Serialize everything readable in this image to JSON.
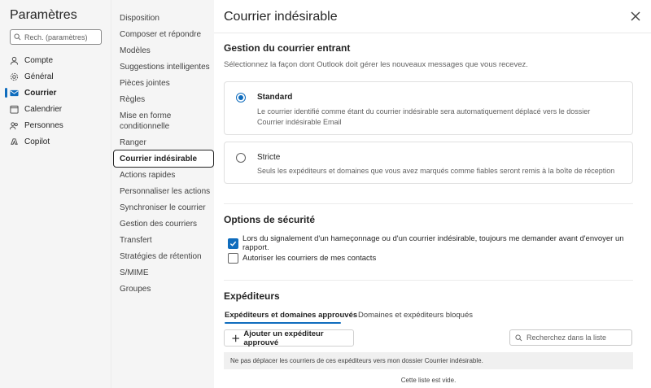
{
  "nav": {
    "title": "Paramètres",
    "search_placeholder": "Rech. (paramètres)",
    "items": [
      {
        "label": "Compte",
        "icon": "person-icon"
      },
      {
        "label": "Général",
        "icon": "gear-icon"
      },
      {
        "label": "Courrier",
        "icon": "mail-icon",
        "active": true
      },
      {
        "label": "Calendrier",
        "icon": "calendar-icon"
      },
      {
        "label": "Personnes",
        "icon": "people-icon"
      },
      {
        "label": "Copilot",
        "icon": "copilot-icon"
      }
    ]
  },
  "subnav": {
    "items": [
      "Disposition",
      "Composer et répondre",
      "Modèles",
      "Suggestions intelligentes",
      "Pièces jointes",
      "Règles",
      "Mise en forme conditionnelle",
      "Ranger",
      "Courrier indésirable",
      "Actions rapides",
      "Personnaliser les actions",
      "Synchroniser le courrier",
      "Gestion des courriers",
      "Transfert",
      "Stratégies de rétention",
      "S/MIME",
      "Groupes"
    ],
    "selected": "Courrier indésirable"
  },
  "main": {
    "title": "Courrier indésirable",
    "incoming": {
      "heading": "Gestion du courrier entrant",
      "description": "Sélectionnez la façon dont Outlook doit gérer les nouveaux messages que vous recevez.",
      "options": [
        {
          "title": "Standard",
          "description": "Le courrier identifié comme étant du courrier indésirable sera automatiquement déplacé vers le dossier Courrier indésirable Email",
          "checked": true
        },
        {
          "title": "Stricte",
          "description": "Seuls les expéditeurs et domaines que vous avez marqués comme fiables seront remis à la boîte de réception",
          "checked": false
        }
      ]
    },
    "security": {
      "heading": "Options de sécurité",
      "options": [
        {
          "label": "Lors du signalement d'un hameçonnage ou d'un courrier indésirable, toujours me demander avant d'envoyer un rapport.",
          "checked": true
        },
        {
          "label": "Autoriser les courriers de mes contacts",
          "checked": false
        }
      ]
    },
    "senders": {
      "heading": "Expéditeurs",
      "tabs": [
        "Expéditeurs et domaines approuvés",
        "Domaines et expéditeurs bloqués"
      ],
      "active_tab": 0,
      "add_button": "Ajouter un expéditeur approuvé",
      "search_placeholder": "Recherchez dans la liste",
      "list_header": "Ne pas déplacer les courriers de ces expéditeurs vers mon dossier Courrier indésirable.",
      "empty_text": "Cette liste est vide."
    }
  },
  "colors": {
    "accent": "#0f6cbd",
    "nav_bg": "#f5f5f5"
  }
}
